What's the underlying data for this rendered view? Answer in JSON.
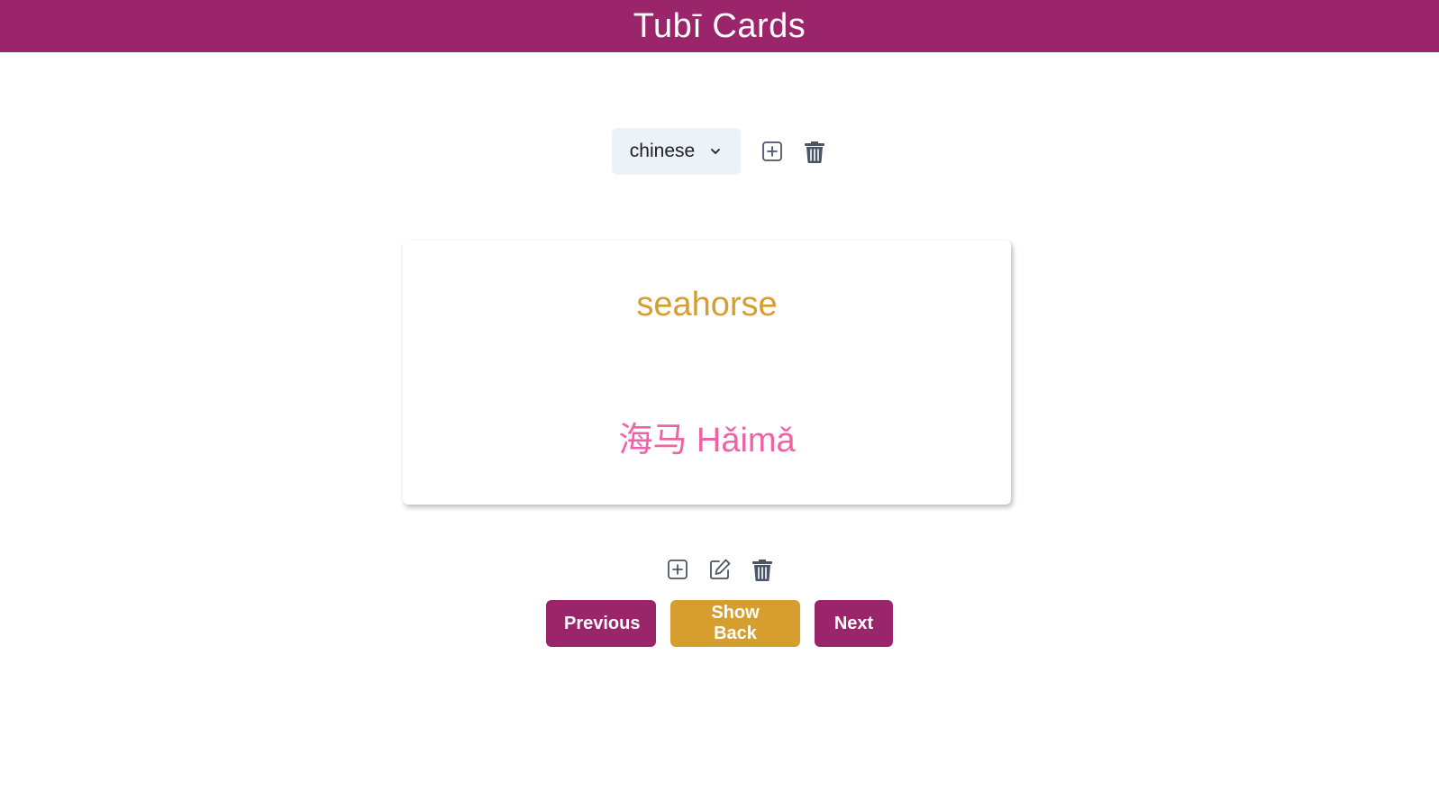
{
  "app": {
    "title": "Tubī Cards"
  },
  "deck": {
    "selected": "chinese"
  },
  "card": {
    "front": "seahorse",
    "back": "海马 Hǎimǎ"
  },
  "navigation": {
    "previous_label": "Previous",
    "show_back_label": "Show Back",
    "next_label": "Next"
  },
  "icons": {
    "deck_add": "plus-square-icon",
    "deck_delete": "trash-icon",
    "card_add": "plus-square-icon",
    "card_edit": "edit-icon",
    "card_delete": "trash-icon"
  },
  "colors": {
    "brand": "#9b256b",
    "accent": "#d69e2e",
    "card_back_text": "#ed64a6",
    "select_bg": "#edf2f7",
    "icon": "#4a5568"
  }
}
